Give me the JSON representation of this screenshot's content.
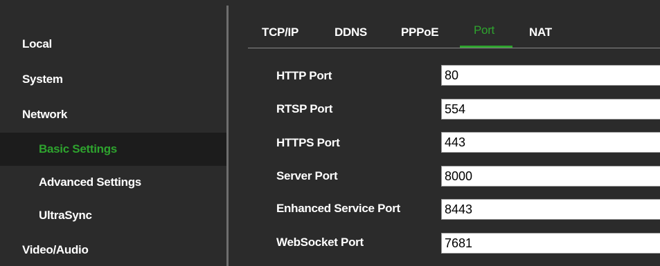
{
  "sidebar": {
    "items": [
      {
        "label": "Local"
      },
      {
        "label": "System"
      },
      {
        "label": "Network"
      },
      {
        "label": "Basic Settings"
      },
      {
        "label": "Advanced Settings"
      },
      {
        "label": "UltraSync"
      },
      {
        "label": "Video/Audio"
      }
    ],
    "active_item": "Basic Settings"
  },
  "tabs": [
    {
      "label": "TCP/IP"
    },
    {
      "label": "DDNS"
    },
    {
      "label": "PPPoE"
    },
    {
      "label": "Port"
    },
    {
      "label": "NAT"
    }
  ],
  "active_tab": "Port",
  "form": {
    "fields": [
      {
        "label": "HTTP Port",
        "value": "80"
      },
      {
        "label": "RTSP Port",
        "value": "554"
      },
      {
        "label": "HTTPS Port",
        "value": "443"
      },
      {
        "label": "Server Port",
        "value": "8000"
      },
      {
        "label": "Enhanced Service Port",
        "value": "8443"
      },
      {
        "label": "WebSocket Port",
        "value": "7681"
      }
    ]
  },
  "colors": {
    "accent": "#2ea32e",
    "background": "#2b2b2b",
    "active_row": "#1c1c1c"
  }
}
